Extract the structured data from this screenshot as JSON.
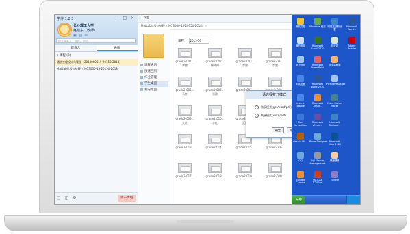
{
  "im": {
    "title": "学伴 1.2.3",
    "window_controls": "— □ ×",
    "school": "长沙理工大学",
    "user": "赵晓东（教师）",
    "search_placeholder": "搜索联系人、文件、群组",
    "tabs": [
      "联系人",
      "通讯"
    ],
    "group_label": "▾ 课程 (2)",
    "items": [
      "通信工程设计与管理（2018060619-20150-2018）",
      "MatLab信号与处理（2013060-15-20150-2018）"
    ],
    "next_button": "第一步吧"
  },
  "browser": {
    "title": "工作台",
    "breadcrumb": "MatLab信号与处理（2013060-15-20150-2018） ›",
    "filter_label": "课程：",
    "filter_value": "2015-01",
    "nav": [
      "课程通讯",
      "快速回到",
      "作业管理",
      "学生桌面",
      "我的桌面"
    ],
    "tiles": [
      {
        "name": "grade2-001...",
        "sub": "李雷"
      },
      {
        "name": "grade2-002...",
        "sub": "韩梅梅"
      },
      {
        "name": "grade2-003...",
        "sub": "李雷"
      },
      {
        "name": "grade2-004...",
        "sub": "李雷"
      },
      {
        "name": "grade2-005...",
        "sub": "马冬"
      },
      {
        "name": "grade2-006...",
        "sub": "张静"
      },
      {
        "name": "grade2-007...",
        "sub": ""
      },
      {
        "name": "grade2-008...",
        "sub": ""
      },
      {
        "name": "grade2-009...",
        "sub": "文文"
      },
      {
        "name": "grade2-010...",
        "sub": "李红"
      },
      {
        "name": "grade2-011...",
        "sub": "武晨"
      },
      {
        "name": "grade2-012...",
        "sub": "白雪"
      },
      {
        "name": "grade2-013...",
        "sub": ""
      },
      {
        "name": "grade2-014...",
        "sub": ""
      },
      {
        "name": "grade2-015...",
        "sub": ""
      },
      {
        "name": "grade2-016...",
        "sub": ""
      },
      {
        "name": "grade2-017...",
        "sub": ""
      },
      {
        "name": "grade2-018...",
        "sub": ""
      },
      {
        "name": "grade2-019...",
        "sub": ""
      },
      {
        "name": "grade2-020...",
        "sub": ""
      }
    ]
  },
  "dialog": {
    "title": "请选择打开模式",
    "option1": "独享模式(ppt/word/pdf)",
    "option2": "共享模式(word/pdf)",
    "ok": "确定",
    "cancel": "取消",
    "close": "×"
  },
  "desktop": {
    "icons": [
      {
        "label": "我的文档",
        "color": "#f1c232"
      },
      {
        "label": "Windows 任务",
        "color": "#6aa84f"
      },
      {
        "label": "网络连接和设置",
        "color": "#3d85c6"
      },
      {
        "label": "Microsoft Word...",
        "color": "#2b5797"
      },
      {
        "label": "我的电脑",
        "color": "#cfe2f3"
      },
      {
        "label": "Microsoft Excel 2010",
        "color": "#38761d"
      },
      {
        "label": "回收站",
        "color": "#d9ead3"
      },
      {
        "label": "Adobe Reader",
        "color": "#cc0000"
      },
      {
        "label": "网上邻居",
        "color": "#9fc5e8"
      },
      {
        "label": "Microsoft PowerPoint",
        "color": "#e06666"
      },
      {
        "label": "学生端程序",
        "color": "#f6b26b"
      },
      {
        "label": "",
        "color": "#1d56c8"
      },
      {
        "label": "IE浏览器",
        "color": "#4a86e8"
      },
      {
        "label": "Microsoft Word 2010",
        "color": "#2b5797"
      },
      {
        "label": "PictureManager",
        "color": "#a4c2f4"
      },
      {
        "label": "",
        "color": "#1d56c8"
      },
      {
        "label": "Internet Explorer",
        "color": "#4a86e8"
      },
      {
        "label": "Microsoft Office...",
        "color": "#e69138"
      },
      {
        "label": "Cisco Packet Tracer",
        "color": "#45818e"
      },
      {
        "label": "",
        "color": "#1d56c8"
      },
      {
        "label": "Sun VirtualBox",
        "color": "#3c78d8"
      },
      {
        "label": "Microsoft Visual...",
        "color": "#674ea7"
      },
      {
        "label": "Microsoft Outlook...",
        "color": "#3d85c6"
      },
      {
        "label": "",
        "color": "#1d56c8"
      },
      {
        "label": "Oracle VM...",
        "color": "#b45f06"
      },
      {
        "label": "PowerDesigner...",
        "color": "#6fa8dc"
      },
      {
        "label": "Microsoft Visio 2010",
        "color": "#0b5394"
      },
      {
        "label": "",
        "color": "#1d56c8"
      },
      {
        "label": "QQ",
        "color": "#6fa8dc"
      },
      {
        "label": "SQL Server Management",
        "color": "#999999"
      },
      {
        "label": "快速通道",
        "color": "#f9cb9c"
      },
      {
        "label": "",
        "color": "#1d56c8"
      },
      {
        "label": "Google Chrome",
        "color": "#e69138"
      },
      {
        "label": "MATLAB R2010a",
        "color": "#cc4125"
      },
      {
        "label": "Eclipse",
        "color": "#8e7cc3"
      },
      {
        "label": "",
        "color": "#1d56c8"
      }
    ],
    "start_label": "开始"
  }
}
